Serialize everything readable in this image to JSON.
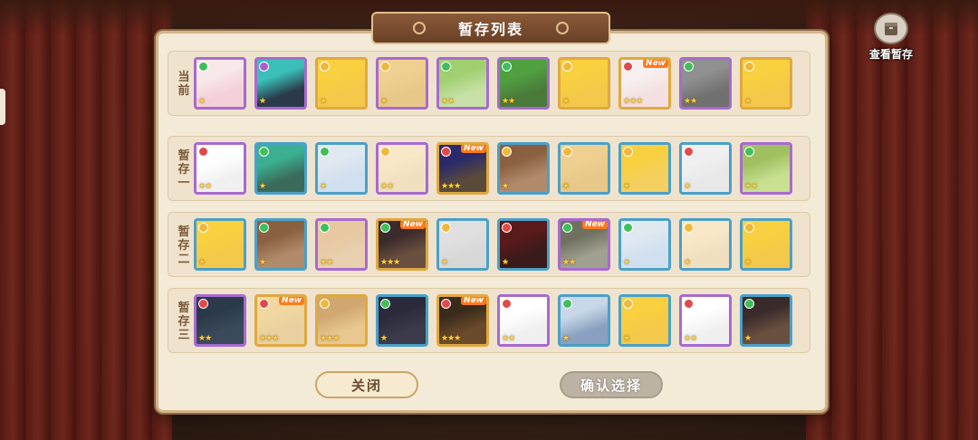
{
  "panel": {
    "title": "暂存列表",
    "view_storage_label": "查看暂存",
    "close_label": "关闭",
    "confirm_label": "确认选择"
  },
  "rows": [
    {
      "label": [
        "当",
        "前"
      ],
      "slots": [
        {
          "elem": "#3fbf5a",
          "frame": "#a86ad0",
          "face": "#f4d0d8",
          "hair": "#f8e8ea",
          "stars": "★",
          "new": ""
        },
        {
          "elem": "#b05ad0",
          "frame": "#a86ad0",
          "face": "#2a3a4a",
          "hair": "#3ac0b8",
          "stars": "★",
          "new": ""
        },
        {
          "elem": "#f0b83a",
          "frame": "#e0a840",
          "face": "#f4c84a",
          "hair": "#f8d040",
          "stars": "★",
          "new": ""
        },
        {
          "elem": "#f0b83a",
          "frame": "#a86ad0",
          "face": "#e8c888",
          "hair": "#f0d090",
          "stars": "★",
          "new": ""
        },
        {
          "elem": "#3fbf5a",
          "frame": "#a86ad0",
          "face": "#c8e0a8",
          "hair": "#a0d070",
          "stars": "★★",
          "new": ""
        },
        {
          "elem": "#3fbf5a",
          "frame": "#a86ad0",
          "face": "#4a7a3a",
          "hair": "#50a040",
          "stars": "★★",
          "new": ""
        },
        {
          "elem": "#f0b83a",
          "frame": "#e0a840",
          "face": "#f4c84a",
          "hair": "#f8d040",
          "stars": "★",
          "new": ""
        },
        {
          "elem": "#e04a4a",
          "frame": "#e0a840",
          "face": "#f4e0e0",
          "hair": "#f8f0f0",
          "stars": "★★★",
          "new": "New"
        },
        {
          "elem": "#3fbf5a",
          "frame": "#a86ad0",
          "face": "#707070",
          "hair": "#909090",
          "stars": "★★",
          "new": ""
        },
        {
          "elem": "#f0b83a",
          "frame": "#e0a840",
          "face": "#f4c84a",
          "hair": "#f8d040",
          "stars": "★",
          "new": ""
        }
      ]
    },
    {
      "label": [
        "暂",
        "存",
        "一"
      ],
      "slots": [
        {
          "elem": "#e04a4a",
          "frame": "#a86ad0",
          "face": "#f0f0f0",
          "hair": "#ffffff",
          "stars": "★★",
          "new": ""
        },
        {
          "elem": "#3fbf5a",
          "frame": "#4aa0c8",
          "face": "#3a6a5a",
          "hair": "#3ab090",
          "stars": "★",
          "new": ""
        },
        {
          "elem": "#3fbf5a",
          "frame": "#4aa0c8",
          "face": "#d0e0f0",
          "hair": "#e0e8f0",
          "stars": "★",
          "new": ""
        },
        {
          "elem": "#f0b83a",
          "frame": "#a86ad0",
          "face": "#f0e0c0",
          "hair": "#f8e8c8",
          "stars": "★★",
          "new": ""
        },
        {
          "elem": "#e04a4a",
          "frame": "#e0a840",
          "face": "#5a4a3a",
          "hair": "#2a2a6a",
          "stars": "★★★",
          "new": "New"
        },
        {
          "elem": "#f0b83a",
          "frame": "#4aa0c8",
          "face": "#b08a6a",
          "hair": "#8a6040",
          "stars": "★",
          "new": ""
        },
        {
          "elem": "#f0b83a",
          "frame": "#4aa0c8",
          "face": "#e8c888",
          "hair": "#f0d090",
          "stars": "★",
          "new": ""
        },
        {
          "elem": "#f0b83a",
          "frame": "#4aa0c8",
          "face": "#f4d060",
          "hair": "#f8d040",
          "stars": "★",
          "new": ""
        },
        {
          "elem": "#e04a4a",
          "frame": "#4aa0c8",
          "face": "#e8e8e8",
          "hair": "#f0f0f0",
          "stars": "★",
          "new": ""
        },
        {
          "elem": "#3fbf5a",
          "frame": "#a86ad0",
          "face": "#c8e090",
          "hair": "#a0c060",
          "stars": "★★",
          "new": ""
        }
      ]
    },
    {
      "label": [
        "暂",
        "存",
        "二"
      ],
      "slots": [
        {
          "elem": "#f0b83a",
          "frame": "#4aa0c8",
          "face": "#f4c84a",
          "hair": "#f8d040",
          "stars": "★",
          "new": ""
        },
        {
          "elem": "#3fbf5a",
          "frame": "#4aa0c8",
          "face": "#b08a6a",
          "hair": "#8a6040",
          "stars": "★",
          "new": ""
        },
        {
          "elem": "#3fbf5a",
          "frame": "#a86ad0",
          "face": "#e8d0b0",
          "hair": "#e8c8a0",
          "stars": "★★",
          "new": ""
        },
        {
          "elem": "#3fbf5a",
          "frame": "#e0a840",
          "face": "#6a5040",
          "hair": "#3a2a2a",
          "stars": "★★★",
          "new": "New"
        },
        {
          "elem": "#f0b83a",
          "frame": "#4aa0c8",
          "face": "#d8d8d8",
          "hair": "#e0e0e0",
          "stars": "★",
          "new": ""
        },
        {
          "elem": "#e04a4a",
          "frame": "#4aa0c8",
          "face": "#3a1a1a",
          "hair": "#5a1a1a",
          "stars": "★",
          "new": ""
        },
        {
          "elem": "#3fbf5a",
          "frame": "#a86ad0",
          "face": "#a0a090",
          "hair": "#707060",
          "stars": "★★",
          "new": "New"
        },
        {
          "elem": "#3fbf5a",
          "frame": "#4aa0c8",
          "face": "#d0e0f0",
          "hair": "#e0e8f0",
          "stars": "★",
          "new": ""
        },
        {
          "elem": "#f0b83a",
          "frame": "#4aa0c8",
          "face": "#f0e0c0",
          "hair": "#f8e8c8",
          "stars": "★",
          "new": ""
        },
        {
          "elem": "#f0b83a",
          "frame": "#4aa0c8",
          "face": "#f4c84a",
          "hair": "#f8d040",
          "stars": "★",
          "new": ""
        }
      ]
    },
    {
      "label": [
        "暂",
        "存",
        "三"
      ],
      "slots": [
        {
          "elem": "#e04a4a",
          "frame": "#a86ad0",
          "face": "#3a4a5a",
          "hair": "#2a3a4a",
          "stars": "★★",
          "new": ""
        },
        {
          "elem": "#e04a4a",
          "frame": "#e0a840",
          "face": "#e8d0a0",
          "hair": "#f0d8a0",
          "stars": "★★★",
          "new": "New"
        },
        {
          "elem": "#f0b83a",
          "frame": "#e0a840",
          "face": "#e8c890",
          "hair": "#d0a870",
          "stars": "★★★",
          "new": ""
        },
        {
          "elem": "#3fbf5a",
          "frame": "#4aa0c8",
          "face": "#3a3a4a",
          "hair": "#2a2a3a",
          "stars": "★",
          "new": ""
        },
        {
          "elem": "#e04a4a",
          "frame": "#e0a840",
          "face": "#6a4a2a",
          "hair": "#3a2a1a",
          "stars": "★★★",
          "new": "New"
        },
        {
          "elem": "#e04a4a",
          "frame": "#a86ad0",
          "face": "#f0f0f0",
          "hair": "#ffffff",
          "stars": "★★",
          "new": ""
        },
        {
          "elem": "#3fbf5a",
          "frame": "#4aa0c8",
          "face": "#8aa0c0",
          "hair": "#c8d8e8",
          "stars": "★",
          "new": ""
        },
        {
          "elem": "#f0b83a",
          "frame": "#4aa0c8",
          "face": "#f4c84a",
          "hair": "#f8d040",
          "stars": "★",
          "new": ""
        },
        {
          "elem": "#e04a4a",
          "frame": "#a86ad0",
          "face": "#f0f0f0",
          "hair": "#ffffff",
          "stars": "★★",
          "new": ""
        },
        {
          "elem": "#3fbf5a",
          "frame": "#4aa0c8",
          "face": "#6a5040",
          "hair": "#3a2a2a",
          "stars": "★",
          "new": ""
        }
      ]
    }
  ]
}
